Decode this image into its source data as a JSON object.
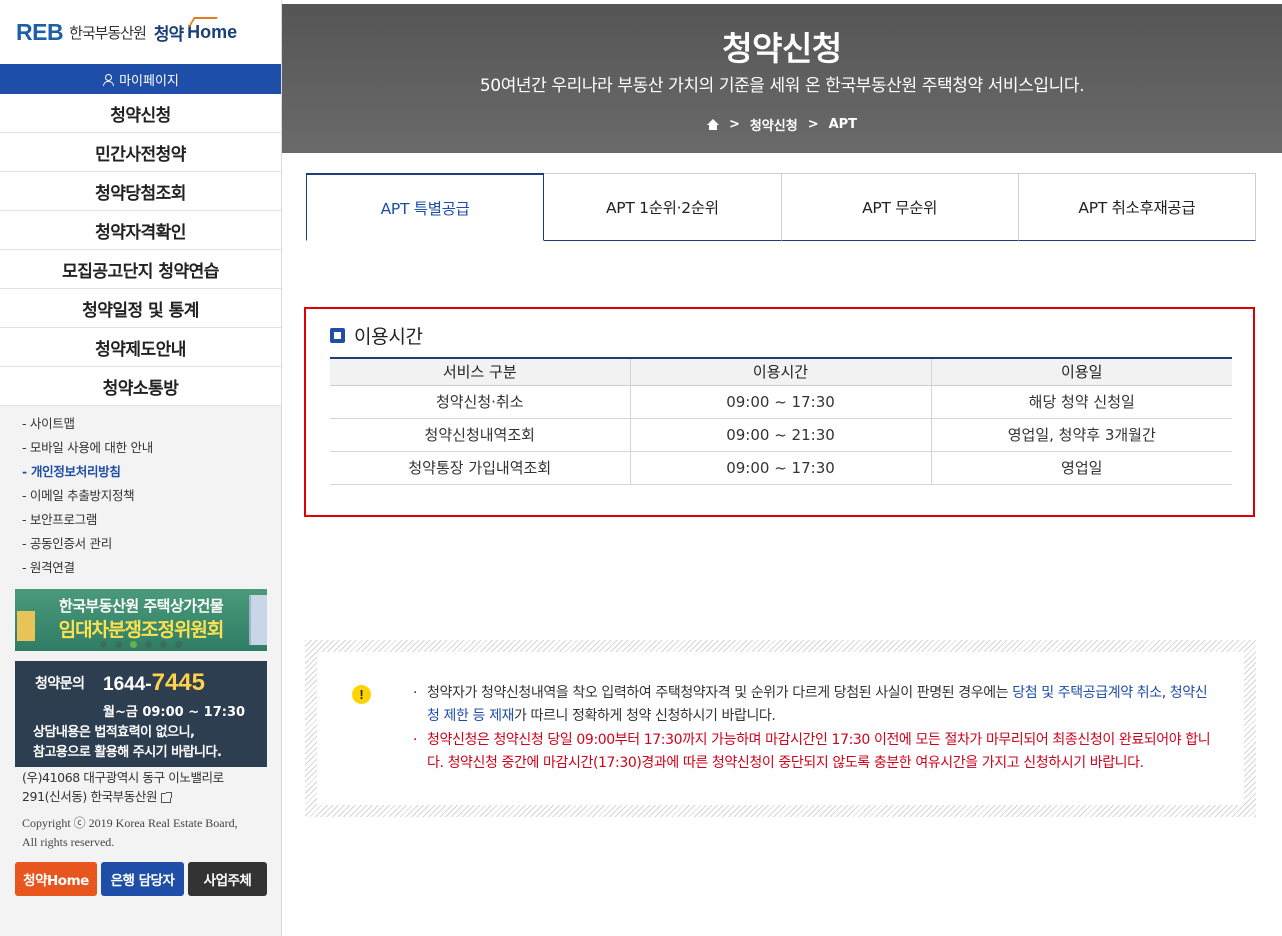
{
  "logo": {
    "mark": "REB",
    "org": "한국부동산원",
    "cy": "청약",
    "home": "Home"
  },
  "sidebar": {
    "mypage": "마이페이지",
    "menu": [
      "청약신청",
      "민간사전청약",
      "청약당첨조회",
      "청약자격확인",
      "모집공고단지 청약연습",
      "청약일정 및 통계",
      "청약제도안내",
      "청약소통방"
    ],
    "links": [
      "- 사이트맵",
      "- 모바일 사용에 대한 안내",
      "- 개인정보처리방침",
      "- 이메일 추출방지정책",
      "- 보안프로그램",
      "- 공동인증서 관리",
      "- 원격연결"
    ],
    "banner": {
      "line1": "한국부동산원 주택상가건물",
      "line2": "임대차분쟁조정위원회"
    },
    "contact": {
      "label": "청약문의",
      "num_prefix": "1644-",
      "num_hl": "7445",
      "hours": "월~금 09:00 ~ 17:30",
      "note1": "상담내용은 법적효력이 없으니,",
      "note2": "참고용으로 활용해 주시기 바랍니다."
    },
    "address1": "(우)41068 대구광역시 동구 이노밸리로",
    "address2": "291(신서동) 한국부동산원",
    "copyright1": "Copyright ⓒ 2019 Korea Real Estate Board,",
    "copyright2": "All rights reserved.",
    "buttons": {
      "home": "청약Home",
      "bank": "은행 담당자",
      "biz": "사업주체"
    }
  },
  "hero": {
    "title": "청약신청",
    "subtitle": "50여년간 우리나라 부동산 가치의 기준을 세워 온 한국부동산원 주택청약 서비스입니다.",
    "crumb1": "청약신청",
    "crumb2": "APT"
  },
  "tabs": [
    "APT 특별공급",
    "APT 1순위·2순위",
    "APT 무순위",
    "APT 취소후재공급"
  ],
  "usage": {
    "title": "이용시간",
    "headers": [
      "서비스 구분",
      "이용시간",
      "이용일"
    ],
    "rows": [
      [
        "청약신청·취소",
        "09:00 ~ 17:30",
        "해당 청약 신청일"
      ],
      [
        "청약신청내역조회",
        "09:00 ~ 21:30",
        "영업일, 청약후 3개월간"
      ],
      [
        "청약통장 가입내역조회",
        "09:00 ~ 17:30",
        "영업일"
      ]
    ]
  },
  "notice": {
    "n1_a": "청약자가 청약신청내역을 착오 입력하여 주택청약자격 및 순위가 다르게 당첨된 사실이 판명된 경우에는 ",
    "n1_link1": "당첨 및 주택공급계약 취소",
    "n1_b": ", ",
    "n1_link2": "청약신청 제한 등 제재",
    "n1_c": "가 따르니 정확하게 청약 신청하시기 바랍니다.",
    "n2": "청약신청은 청약신청 당일 09:00부터 17:30까지 가능하며 마감시간인 17:30 이전에 모든 절차가 마무리되어 최종신청이 완료되어야 합니다. 청약신청 중간에 마감시간(17:30)경과에 따른 청약신청이 중단되지 않도록 충분한 여유시간을 가지고 신청하시기 바랍니다."
  },
  "colors": {
    "primary": "#1e4ea8",
    "alert": "#e00000",
    "hero": "#5f5f5f",
    "warn": "#ffd400"
  }
}
